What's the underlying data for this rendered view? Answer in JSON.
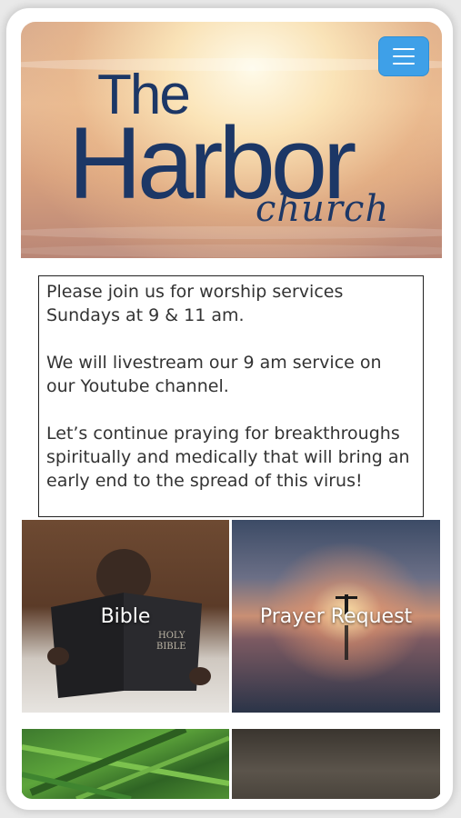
{
  "header": {
    "logo_the": "The",
    "logo_harbor": "Harbor",
    "logo_church": "church",
    "menu_icon": "hamburger-menu-icon",
    "menu_color": "#3ea0e8",
    "brand_color": "#1c3766"
  },
  "message": {
    "paragraph_1": "Please join us for worship services Sundays at 9 & 11 am.",
    "paragraph_2": "We will livestream our 9 am service on our Youtube channel.",
    "paragraph_3": "Let’s continue praying for breakthroughs spiritually and medically that will bring an early end to the spread of this virus!"
  },
  "tiles": {
    "bible": "Bible",
    "prayer_request": "Prayer Request"
  }
}
